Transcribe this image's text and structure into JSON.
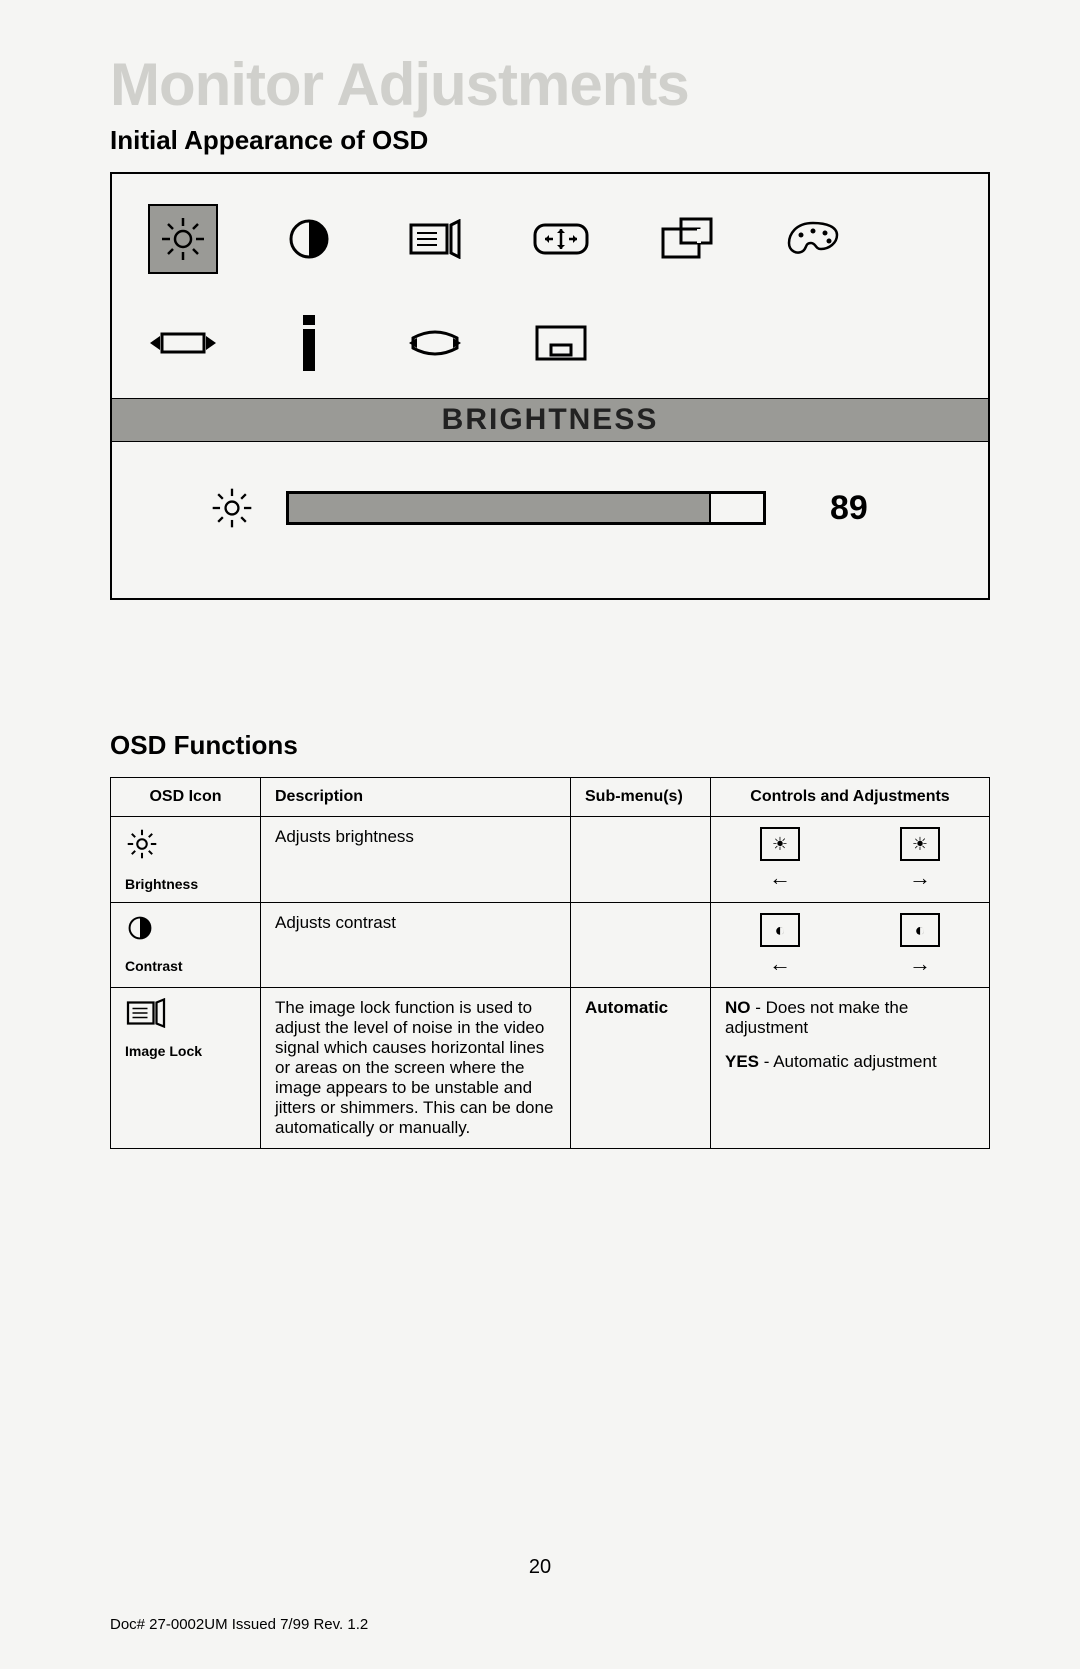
{
  "page": {
    "title": "Monitor Adjustments",
    "section1": "Initial Appearance of OSD",
    "section2": "OSD Functions",
    "page_number": "20",
    "doc_footer": "Doc# 27-0002UM Issued 7/99 Rev. 1.2"
  },
  "osd": {
    "selected_label": "BRIGHTNESS",
    "value": "89",
    "icons_row1": [
      "brightness",
      "contrast",
      "image-lock",
      "position",
      "size",
      "color"
    ],
    "icons_row2": [
      "hsize",
      "vbar",
      "tilt",
      "window"
    ]
  },
  "table": {
    "headers": {
      "col1": "OSD Icon",
      "col2": "Description",
      "col3": "Sub-menu(s)",
      "col4": "Controls and Adjustments"
    },
    "rows": [
      {
        "icon_label": "Brightness",
        "description": "Adjusts brightness",
        "submenu": "",
        "controls": {
          "type": "arrows"
        }
      },
      {
        "icon_label": "Contrast",
        "description": "Adjusts contrast",
        "submenu": "",
        "controls": {
          "type": "arrows"
        }
      },
      {
        "icon_label": "Image Lock",
        "description": "The image lock function is used to adjust the level of noise in the video signal which causes horizontal lines or areas on the screen where the image appears to be unstable and jitters or shimmers. This can be done automatically or manually.",
        "submenu": "Automatic",
        "controls": {
          "type": "text",
          "no_label": "NO",
          "no_text": " - Does not make the adjustment",
          "yes_label": "YES",
          "yes_text": " - Automatic adjustment"
        }
      }
    ]
  }
}
